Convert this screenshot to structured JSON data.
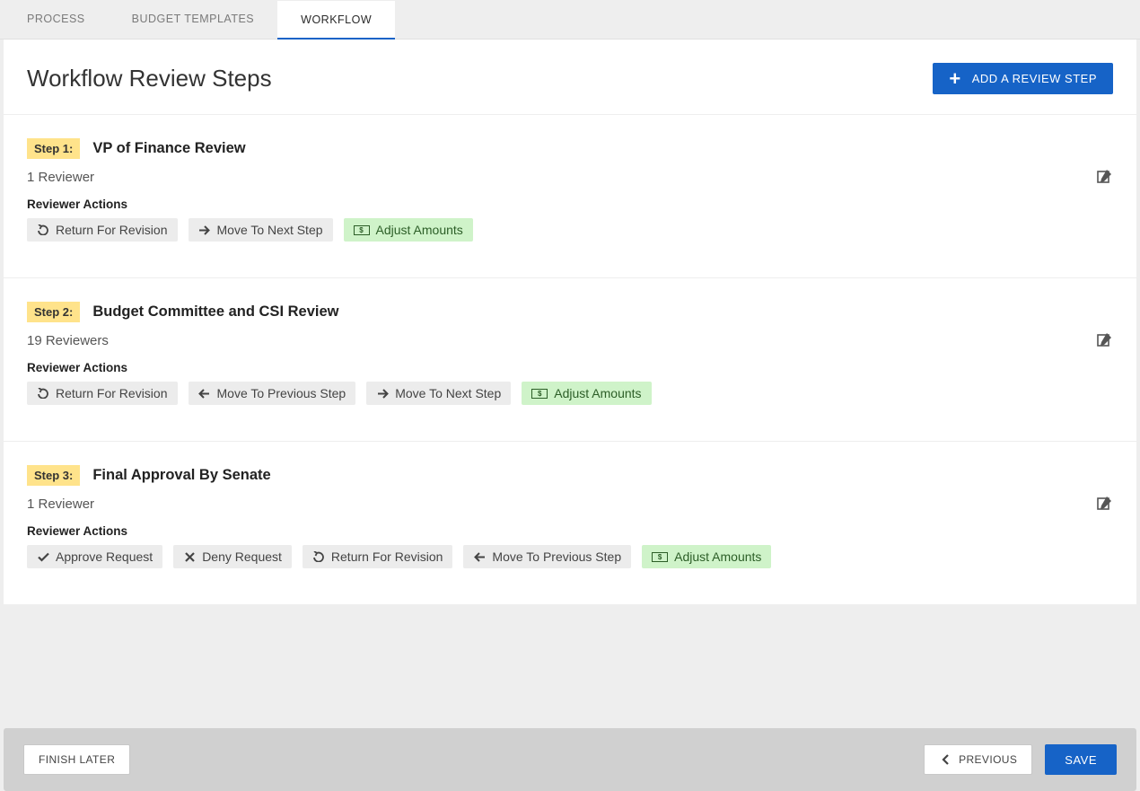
{
  "tabs": [
    "PROCESS",
    "BUDGET TEMPLATES",
    "WORKFLOW"
  ],
  "active_tab": 2,
  "page_title": "Workflow Review Steps",
  "add_button": "ADD A REVIEW STEP",
  "actions_label": "Reviewer Actions",
  "action_labels": {
    "return": "Return For Revision",
    "next": "Move To Next Step",
    "prev": "Move To Previous Step",
    "adjust": "Adjust Amounts",
    "approve": "Approve Request",
    "deny": "Deny Request"
  },
  "steps": [
    {
      "badge": "Step 1:",
      "title": "VP of Finance Review",
      "reviewers": "1 Reviewer",
      "actions": [
        "return",
        "next",
        "adjust"
      ]
    },
    {
      "badge": "Step 2:",
      "title": "Budget Committee and CSI Review",
      "reviewers": "19 Reviewers",
      "actions": [
        "return",
        "prev",
        "next",
        "adjust"
      ]
    },
    {
      "badge": "Step 3:",
      "title": "Final Approval By Senate",
      "reviewers": "1 Reviewer",
      "actions": [
        "approve",
        "deny",
        "return",
        "prev",
        "adjust"
      ]
    }
  ],
  "footer": {
    "finish_later": "FINISH LATER",
    "previous": "PREVIOUS",
    "save": "SAVE"
  }
}
